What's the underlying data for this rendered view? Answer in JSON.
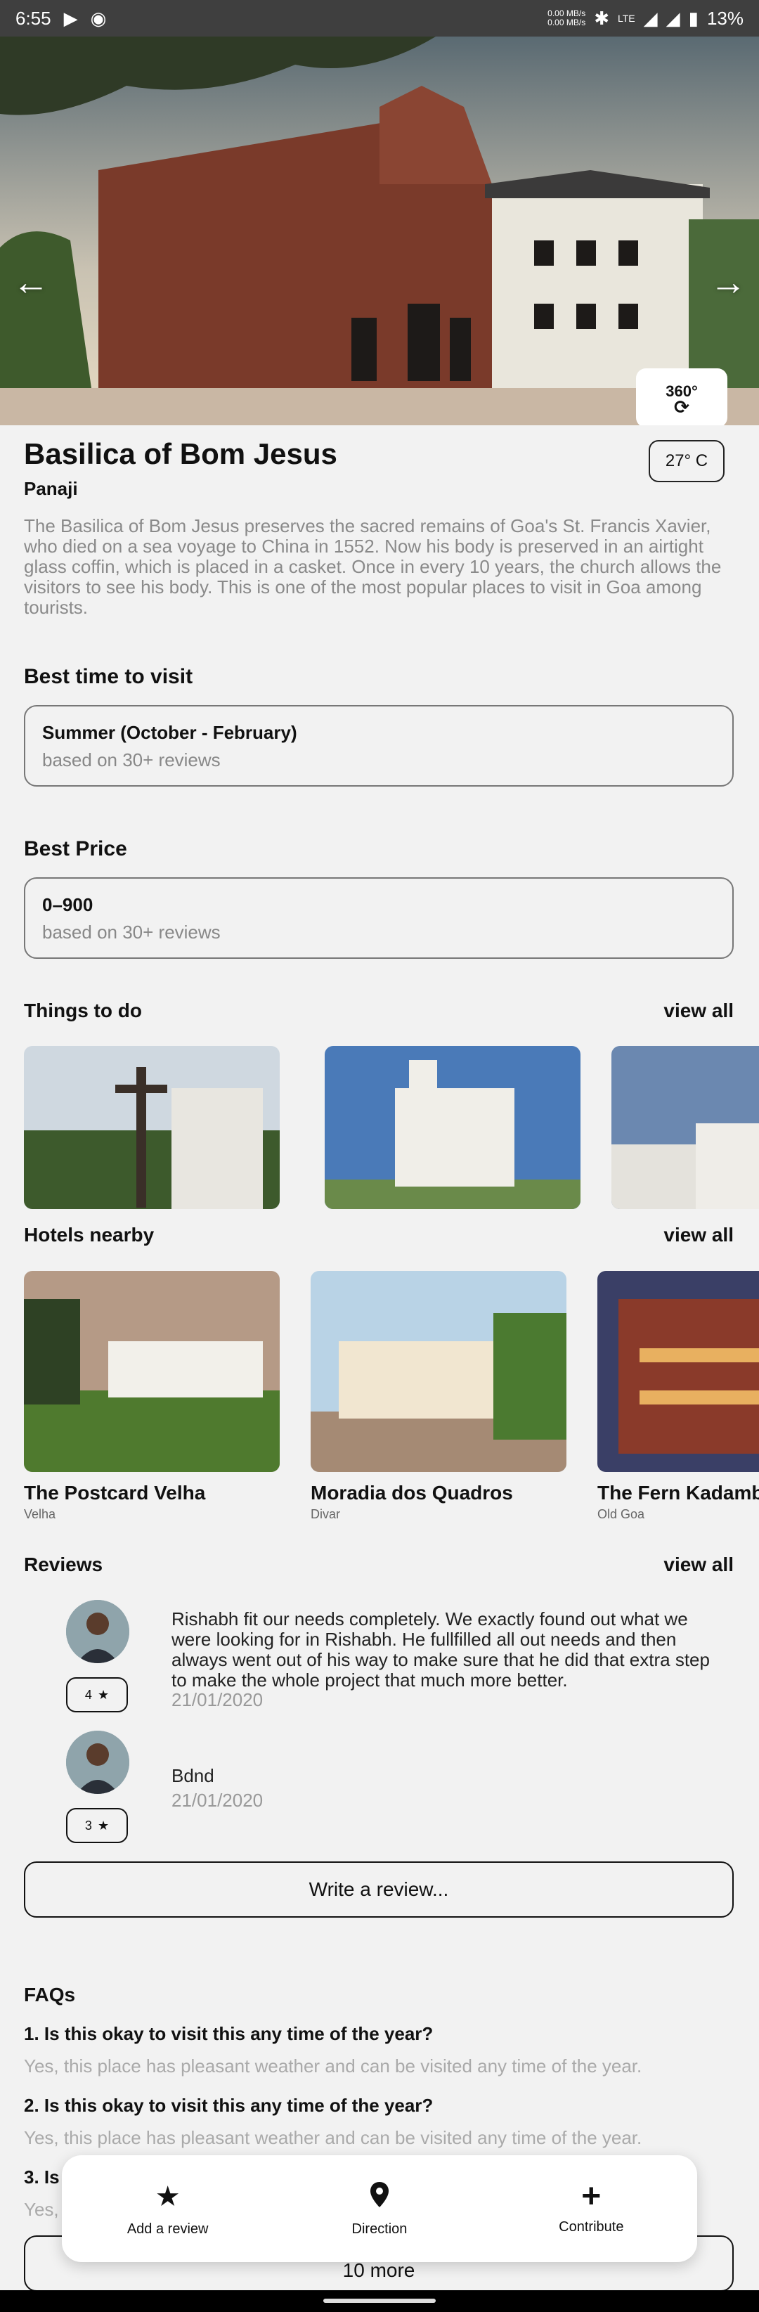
{
  "status_bar": {
    "time": "6:55",
    "speed_up": "0.00 MB/s",
    "speed_down": "0.00 MB/s",
    "network": "LTE",
    "battery": "13%"
  },
  "place": {
    "name": "Basilica of Bom Jesus",
    "city": "Panaji",
    "temperature": "27° C",
    "description": "The Basilica of Bom Jesus preserves the sacred remains of Goa's St. Francis Xavier, who died on a sea voyage to China in 1552. Now his body is preserved in an airtight glass coffin, which is placed in a casket. Once in every 10 years, the church allows the visitors to see his body. This is one of the most popular places to visit in Goa among tourists.",
    "view_360": "360°"
  },
  "best_time": {
    "heading": "Best time to visit",
    "value": "Summer (October - February)",
    "sub": "based on 30+ reviews"
  },
  "best_price": {
    "heading": "Best Price",
    "value": "0–900",
    "sub": "based on 30+ reviews"
  },
  "things_to_do": {
    "heading": "Things to do",
    "view_all": "view all"
  },
  "hotels": {
    "heading": "Hotels nearby",
    "view_all": "view all",
    "items": [
      {
        "name": "The Postcard Velha",
        "location": "Velha"
      },
      {
        "name": "Moradia dos Quadros",
        "location": "Divar"
      },
      {
        "name": "The Fern Kadambari",
        "location": "Old Goa"
      }
    ]
  },
  "reviews": {
    "heading": "Reviews",
    "view_all": "view all",
    "items": [
      {
        "rating": "4",
        "text": "Rishabh fit our needs completely. We exactly found out what we were looking for in Rishabh. He fullfilled all out needs and then always went out of his way to make sure that he did that extra step to make the whole project that much more better.",
        "date": "21/01/2020"
      },
      {
        "rating": "3",
        "text": "Bdnd",
        "date": "21/01/2020"
      }
    ],
    "write_button": "Write a review..."
  },
  "faqs": {
    "heading": "FAQs",
    "items": [
      {
        "q": "1. Is this okay to visit this any time of the year?",
        "a": "Yes, this place has pleasant weather and can be visited any time of the year."
      },
      {
        "q": "2. Is this okay to visit this any time of the year?",
        "a": "Yes, this place has pleasant weather and can be visited any time of the year."
      },
      {
        "q": "3. Is",
        "a": "Yes,"
      }
    ],
    "more_button": "10 more"
  },
  "bottom_nav": {
    "add_review": "Add a review",
    "direction": "Direction",
    "contribute": "Contribute"
  }
}
